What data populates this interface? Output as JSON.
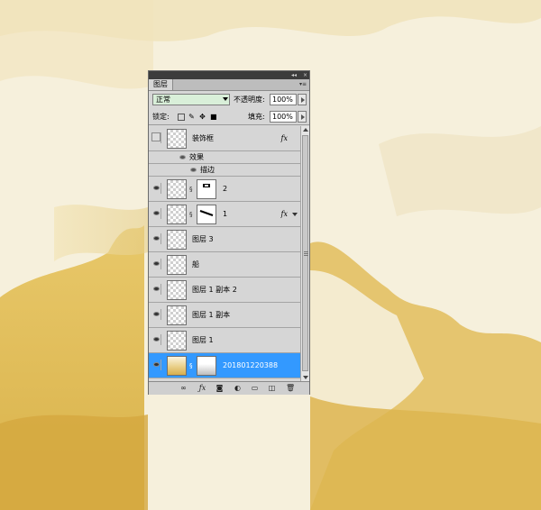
{
  "panel": {
    "tab_label": "图层",
    "collapse_glyph": "◂◂",
    "close_glyph": "×",
    "menu_glyph": "▾≡"
  },
  "blend": {
    "mode": "正常",
    "opacity_label": "不透明度:",
    "opacity_value": "100%",
    "lock_label": "锁定:",
    "fill_label": "填充:",
    "fill_value": "100%"
  },
  "layers": [
    {
      "name": "装饰框",
      "visible": false,
      "fx": "fx",
      "effects_label": "效果",
      "stroke_label": "描边"
    },
    {
      "name": "2",
      "visible": true,
      "has_mask": true
    },
    {
      "name": "1",
      "visible": true,
      "has_mask": true,
      "fx": "fx"
    },
    {
      "name": "图层 3",
      "visible": true
    },
    {
      "name": "船",
      "visible": true
    },
    {
      "name": "图层 1 副本 2",
      "visible": true
    },
    {
      "name": "图层 1 副本",
      "visible": true
    },
    {
      "name": "图层 1",
      "visible": true
    },
    {
      "name": "201801220388",
      "visible": true,
      "has_mask": true,
      "selected": true
    }
  ],
  "colors": {
    "selected_row": "#3399ff",
    "blend_field": "#d9efd9",
    "panel_bg": "#d6d6d6"
  },
  "icons": [
    "link-layers-icon",
    "add-style-icon",
    "add-mask-icon",
    "adjustment-layer-icon",
    "new-group-icon",
    "new-layer-icon",
    "delete-layer-icon"
  ]
}
